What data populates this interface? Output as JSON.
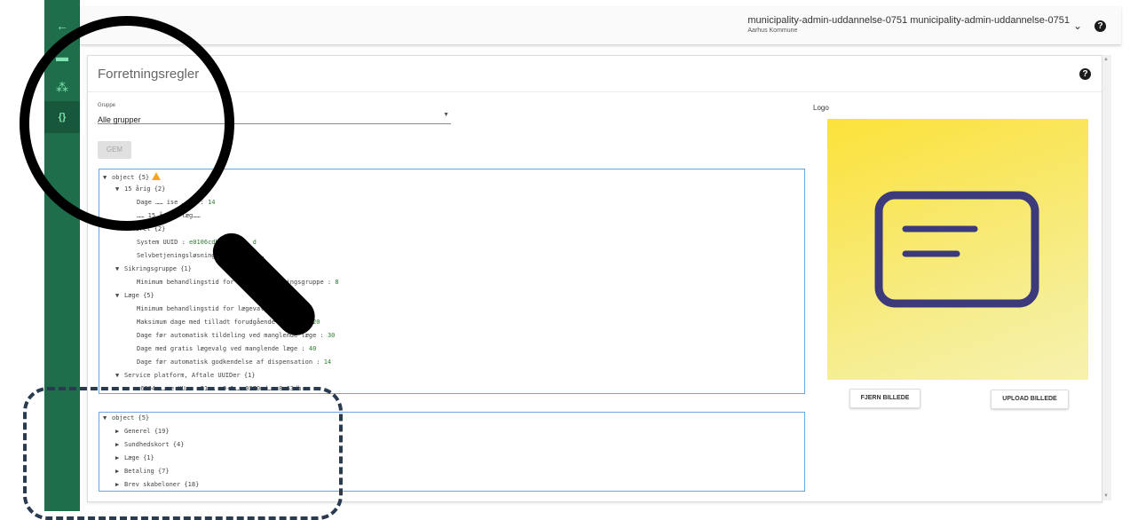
{
  "sidebar": {
    "back_icon": "←",
    "items": [
      {
        "icon": "▬",
        "name": "document-icon"
      },
      {
        "icon": "⁂",
        "name": "hierarchy-icon"
      },
      {
        "icon": "{}",
        "name": "code-braces-icon"
      }
    ]
  },
  "topbar": {
    "user_name": "municipality-admin-uddannelse-0751 municipality-admin-uddannelse-0751",
    "organization": "Aarhus Kommune",
    "chevron": "⌄",
    "help": "?"
  },
  "page": {
    "title": "Forretningsregler",
    "help": "?",
    "group_label": "Gruppe",
    "group_value": "Alle grupper",
    "save_label": "GEM",
    "logo_label": "Logo",
    "remove_image_label": "FJERN BILLEDE",
    "upload_image_label": "UPLOAD BILLEDE"
  },
  "json_tree_1": [
    {
      "indent": 0,
      "tri": "▼",
      "text": "object {5}",
      "value": "",
      "warn": true
    },
    {
      "indent": 1,
      "tri": "▼",
      "text": "15 årig {2}",
      "value": ""
    },
    {
      "indent": 2,
      "tri": "",
      "text": "Dage …… ise …… g : ",
      "value": "14"
    },
    {
      "indent": 2,
      "tri": "",
      "text": "…… 15 årigs læg……",
      "value": ""
    },
    {
      "indent": 1,
      "tri": "▼",
      "text": "Generel {2}",
      "value": ""
    },
    {
      "indent": 2,
      "tri": "",
      "text": "System UUID : ",
      "value": "e0106cdb-cc74-…… d"
    },
    {
      "indent": 2,
      "tri": "",
      "text": "Selvbetjeningsløsningens session……",
      "value": ""
    },
    {
      "indent": 1,
      "tri": "▼",
      "text": "Sikringsgruppe {1}",
      "value": ""
    },
    {
      "indent": 2,
      "tri": "",
      "text": "Minimum behandlingstid for skift af sikringsgruppe : ",
      "value": "8"
    },
    {
      "indent": 1,
      "tri": "▼",
      "text": "Læge {5}",
      "value": ""
    },
    {
      "indent": 2,
      "tri": "",
      "text": "Minimum behandlingstid for lægevalg : ",
      "value": "10"
    },
    {
      "indent": 2,
      "tri": "",
      "text": "Maksimum dage med tilladt forudgående varsel : ",
      "value": "20"
    },
    {
      "indent": 2,
      "tri": "",
      "text": "Dage før automatisk tildeling ved manglende læge : ",
      "value": "30"
    },
    {
      "indent": 2,
      "tri": "",
      "text": "Dage med gratis lægevalg ved manglende læge : ",
      "value": "40"
    },
    {
      "indent": 2,
      "tri": "",
      "text": "Dage før automatisk godkendelse af dispensation : ",
      "value": "14"
    },
    {
      "indent": 1,
      "tri": "▼",
      "text": "Service platform, Aftale UUIDer {1}",
      "value": ""
    },
    {
      "indent": 2,
      "tri": "",
      "text": "…6004 …… e UU…… e21…… a9-1…… 0370-d…… 8c63db",
      "value": ""
    }
  ],
  "json_tree_2": [
    {
      "indent": 0,
      "tri": "▼",
      "text": "object {5}"
    },
    {
      "indent": 1,
      "tri": "▶",
      "text": "Generel {19}"
    },
    {
      "indent": 1,
      "tri": "▶",
      "text": "Sundhedskort {4}"
    },
    {
      "indent": 1,
      "tri": "▶",
      "text": "Læge {1}"
    },
    {
      "indent": 1,
      "tri": "▶",
      "text": "Betaling {7}"
    },
    {
      "indent": 1,
      "tri": "▶",
      "text": "Brev skabeloner {18}"
    }
  ],
  "colors": {
    "sidebar": "#1f6e4b",
    "sidebar_icon": "#7ee3b0",
    "json_border": "#6ea6dc",
    "json_value": "#2e7d32",
    "logo_bg": "#fce23a",
    "logo_icon": "#3c3a7a"
  }
}
